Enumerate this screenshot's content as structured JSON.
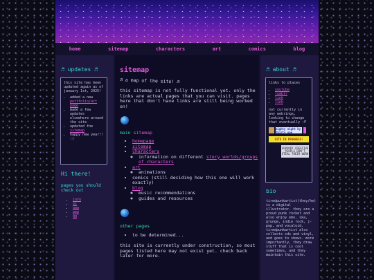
{
  "nav": {
    "items": [
      "home",
      "sitemap",
      "characters",
      "art",
      "comics",
      "blog"
    ]
  },
  "updates": {
    "heading": "♬ updates ♬",
    "intro": "this site has been updated again as of january 1st, 2025!",
    "items": [
      {
        "pre": "added a new ",
        "link": "portfolio/art page",
        "post": ""
      },
      {
        "pre": "made a few updates elsewhere around the site",
        "link": "",
        "post": ""
      },
      {
        "pre": "updated the ",
        "link": "sitemap",
        "post": ""
      },
      {
        "pre": "happy new year!! :)",
        "link": "",
        "post": ""
      }
    ]
  },
  "hi": {
    "heading": "Hi there!",
    "sub": "pages you should check out",
    "links": [
      "info",
      "oc",
      "aaa",
      "ppp",
      "gg"
    ]
  },
  "main": {
    "title": "sitemap",
    "wavy": "♬ a map of the site! ♬",
    "intro": "this sitemap is not fully functional yet. only the links are actual pages that you can visit. pages here that don't have links are still being worked on!",
    "section_label_a": "main",
    "section_label_b": "sitemap",
    "tree": [
      {
        "label": "homepage",
        "link": true,
        "children": []
      },
      {
        "label": "sitemap",
        "link": true,
        "children": []
      },
      {
        "label": "characters",
        "link": true,
        "children": [
          {
            "pre": "information on different ",
            "link": "story worlds/groups of characters"
          }
        ]
      },
      {
        "label": "art",
        "link": true,
        "children": [
          {
            "pre": "animations",
            "link": ""
          }
        ]
      },
      {
        "label": "comics (still deciding how this one will work exactly)",
        "link": false,
        "children": []
      },
      {
        "label": "blog",
        "link": true,
        "children": [
          {
            "pre": "music recommendations",
            "link": ""
          },
          {
            "pre": "guides and resources",
            "link": ""
          }
        ]
      }
    ],
    "other_label": "other pages",
    "other_items": [
      "to be determined..."
    ],
    "footer": "this site is currently under construction, so most pages listed here may not exist yet. check back later for more."
  },
  "about": {
    "heading": "♬ about ♬",
    "links_label": "links to places",
    "links": [
      "youtube",
      "tumblr",
      "link",
      "link"
    ],
    "note": "not currently in any webrings, looking to change that eventually :P",
    "badges": [
      "eighty eight by thirty one",
      "SITE IN PROGRESS!",
      "SUPPORT CREATIVE PEOPLE DON'T STEAL THEIR WORK"
    ]
  },
  "bio": {
    "heading": "bio",
    "text": "tiredpunkartist(they/he) is a digital illustrator. they are a proud punk rocker and also enjoy emo, ska, grunge, indie rock, j-pop, and vocaloid. tiredpunkartist also collects cds and vinyl, and goes to shows. more importantly, they draw stuff that is cool sometimes, and they maintain this site."
  }
}
